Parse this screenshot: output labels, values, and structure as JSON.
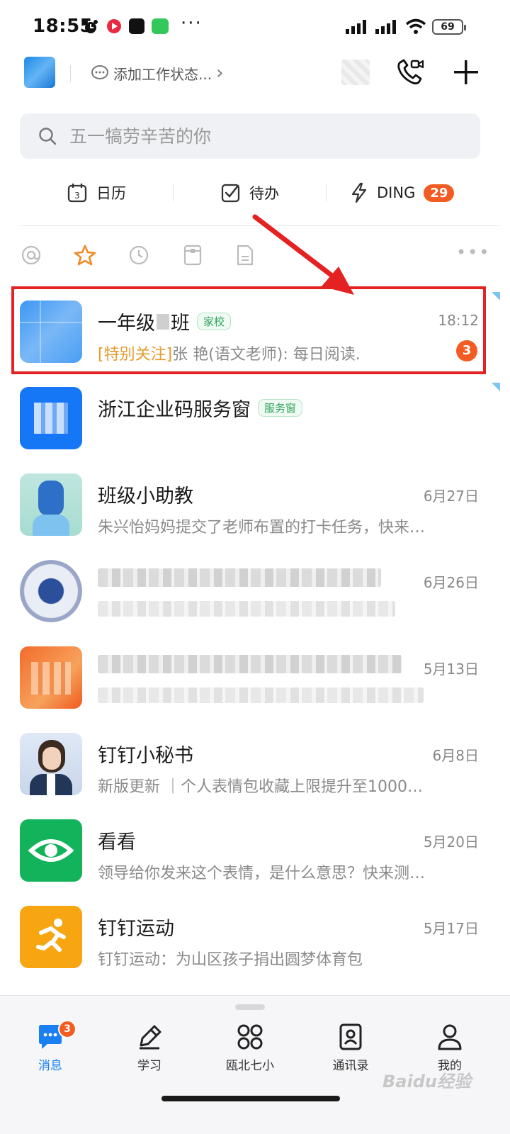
{
  "status_bar": {
    "time": "18:55",
    "more": "···",
    "battery": "69"
  },
  "header": {
    "work_status": "添加工作状态...",
    "chevron": "›"
  },
  "search": {
    "placeholder": "五一犒劳辛苦的你"
  },
  "quick_actions": [
    {
      "label": "日历",
      "icon": "calendar-icon"
    },
    {
      "label": "待办",
      "icon": "todo-check-icon"
    },
    {
      "label": "DING",
      "icon": "lightning-icon",
      "badge": "29"
    }
  ],
  "filters": [
    "at-icon",
    "star-icon",
    "clock-icon",
    "doc-tray-icon",
    "file-icon"
  ],
  "conversations": [
    {
      "name": "一年级",
      "name_suffix": "班",
      "tag": "家校",
      "time": "18:12",
      "special_label": "[特别关注]",
      "preview": "张  艳(语文老师): 每日阅读.",
      "unread": "3"
    },
    {
      "name": "浙江企业码服务窗",
      "tag": "服务窗",
      "time": "",
      "preview": ""
    },
    {
      "name": "班级小助教",
      "time": "6月27日",
      "preview": "朱兴怡妈妈提交了老师布置的打卡任务，快来…"
    },
    {
      "name": "",
      "time": "6月26日",
      "preview": ""
    },
    {
      "name": "",
      "time": "5月13日",
      "preview": ""
    },
    {
      "name": "钉钉小秘书",
      "time": "6月8日",
      "preview": "新版更新 ｜个人表情包收藏上限提升至1000…"
    },
    {
      "name": "看看",
      "time": "5月20日",
      "preview": "领导给你发来这个表情，是什么意思？快来测…"
    },
    {
      "name": "钉钉运动",
      "time": "5月17日",
      "preview": "钉钉运动：为山区孩子捐出圆梦体育包"
    }
  ],
  "tabs": [
    {
      "label": "消息",
      "badge": "3",
      "active": true
    },
    {
      "label": "学习"
    },
    {
      "label": "瓯北七小"
    },
    {
      "label": "通讯录"
    },
    {
      "label": "我的"
    }
  ],
  "watermark": "Baidu经验",
  "colors": {
    "accent": "#1a7ff0",
    "badge": "#f25c22",
    "highlight": "#e52222",
    "special": "#e69b2c"
  }
}
